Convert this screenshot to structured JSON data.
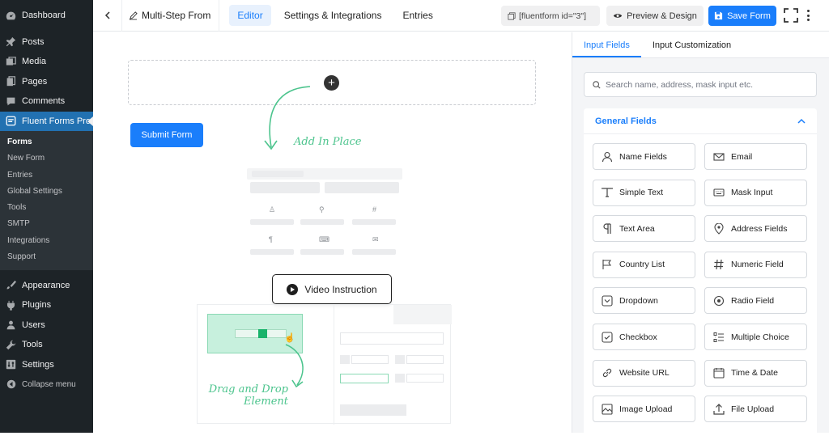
{
  "sidebar": {
    "top": [
      {
        "label": "Dashboard",
        "icon": "dashboard-icon"
      },
      {
        "label": "Posts",
        "icon": "pin-icon"
      },
      {
        "label": "Media",
        "icon": "media-icon"
      },
      {
        "label": "Pages",
        "icon": "pages-icon"
      },
      {
        "label": "Comments",
        "icon": "comments-icon"
      },
      {
        "label": "Fluent Forms Pro",
        "icon": "fluent-forms-icon"
      }
    ],
    "sub": [
      "Forms",
      "New Form",
      "Entries",
      "Global Settings",
      "Tools",
      "SMTP",
      "Integrations",
      "Support"
    ],
    "bottom": [
      {
        "label": "Appearance",
        "icon": "brush-icon"
      },
      {
        "label": "Plugins",
        "icon": "plug-icon"
      },
      {
        "label": "Users",
        "icon": "users-icon"
      },
      {
        "label": "Tools",
        "icon": "wrench-icon"
      },
      {
        "label": "Settings",
        "icon": "settings-icon"
      },
      {
        "label": "Collapse menu",
        "icon": "collapse-icon"
      }
    ]
  },
  "topbar": {
    "form_title": "Multi-Step From",
    "tabs": [
      "Editor",
      "Settings & Integrations",
      "Entries"
    ],
    "shortcode": "[fluentform id=\"3\"]",
    "preview_label": "Preview & Design",
    "save_label": "Save Form"
  },
  "canvas": {
    "submit_label": "Submit Form",
    "add_hint": "Add In Place",
    "drag_hint_1": "Drag and Drop",
    "drag_hint_2": "Element",
    "video_label": "Video Instruction"
  },
  "panel": {
    "tabs": [
      "Input Fields",
      "Input Customization"
    ],
    "search_placeholder": "Search name, address, mask input etc.",
    "section_title": "General Fields",
    "fields": [
      {
        "label": "Name Fields",
        "icon": "user-icon"
      },
      {
        "label": "Email",
        "icon": "email-icon"
      },
      {
        "label": "Simple Text",
        "icon": "text-icon"
      },
      {
        "label": "Mask Input",
        "icon": "keyboard-icon"
      },
      {
        "label": "Text Area",
        "icon": "paragraph-icon"
      },
      {
        "label": "Address Fields",
        "icon": "location-icon"
      },
      {
        "label": "Country List",
        "icon": "flag-icon"
      },
      {
        "label": "Numeric Field",
        "icon": "hash-icon"
      },
      {
        "label": "Dropdown",
        "icon": "dropdown-icon"
      },
      {
        "label": "Radio Field",
        "icon": "radio-icon"
      },
      {
        "label": "Checkbox",
        "icon": "checkbox-icon"
      },
      {
        "label": "Multiple Choice",
        "icon": "list-icon"
      },
      {
        "label": "Website URL",
        "icon": "link-icon"
      },
      {
        "label": "Time & Date",
        "icon": "calendar-icon"
      },
      {
        "label": "Image Upload",
        "icon": "image-icon"
      },
      {
        "label": "File Upload",
        "icon": "upload-icon"
      }
    ]
  },
  "colors": {
    "accent": "#1a7efb",
    "wp_sidebar": "#1d2327",
    "wp_active": "#2271b1",
    "hint_green": "#4cc48d"
  }
}
